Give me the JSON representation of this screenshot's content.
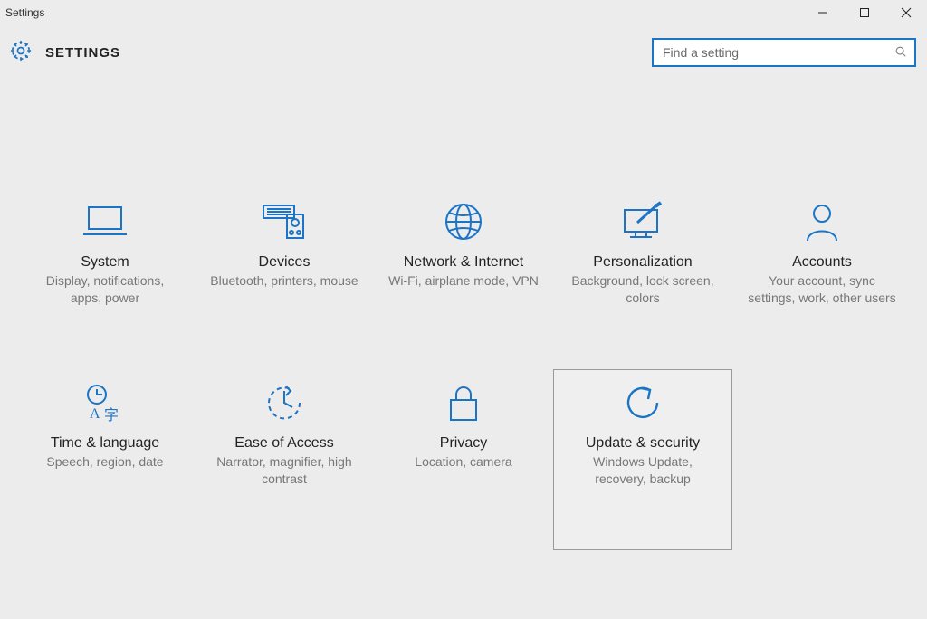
{
  "window": {
    "title": "Settings"
  },
  "header": {
    "page_title": "SETTINGS",
    "search_placeholder": "Find a setting"
  },
  "tiles": [
    {
      "id": "system",
      "title": "System",
      "desc": "Display, notifications, apps, power"
    },
    {
      "id": "devices",
      "title": "Devices",
      "desc": "Bluetooth, printers, mouse"
    },
    {
      "id": "network",
      "title": "Network & Internet",
      "desc": "Wi-Fi, airplane mode, VPN"
    },
    {
      "id": "personalization",
      "title": "Personalization",
      "desc": "Background, lock screen, colors"
    },
    {
      "id": "accounts",
      "title": "Accounts",
      "desc": "Your account, sync settings, work, other users"
    },
    {
      "id": "time-language",
      "title": "Time & language",
      "desc": "Speech, region, date"
    },
    {
      "id": "ease-of-access",
      "title": "Ease of Access",
      "desc": "Narrator, magnifier, high contrast"
    },
    {
      "id": "privacy",
      "title": "Privacy",
      "desc": "Location, camera"
    },
    {
      "id": "update-security",
      "title": "Update & security",
      "desc": "Windows Update, recovery, backup"
    }
  ],
  "hovered_tile": "update-security"
}
